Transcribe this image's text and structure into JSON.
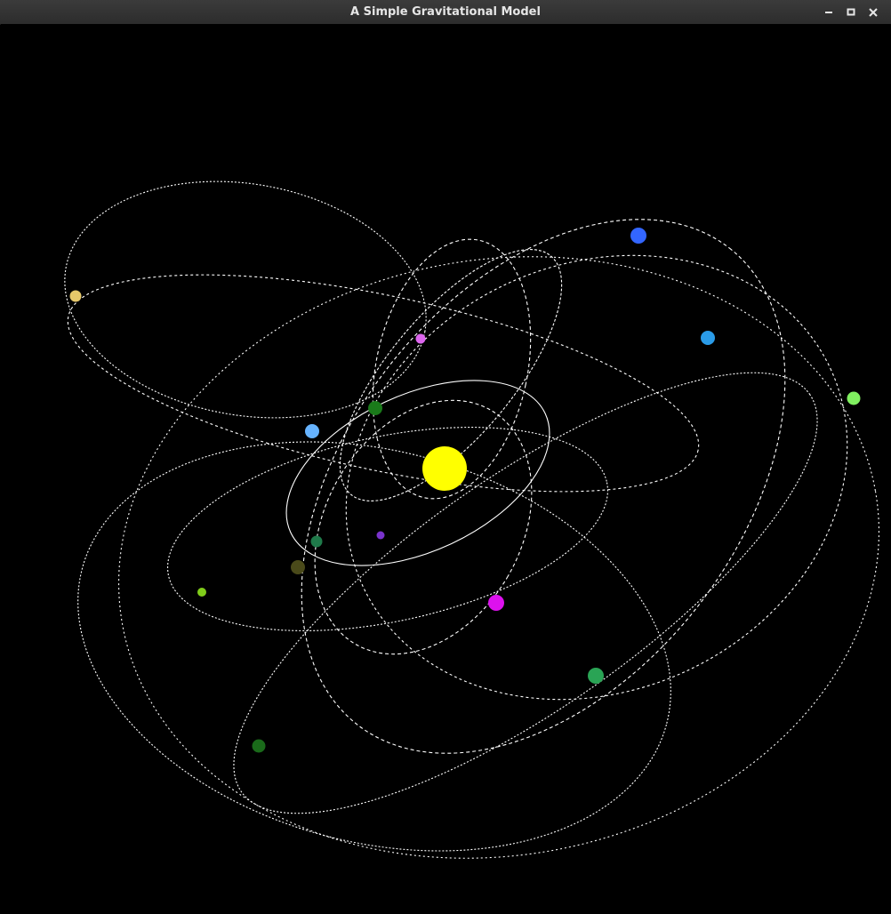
{
  "window": {
    "title": "A Simple Gravitational Model",
    "buttons": [
      {
        "name": "minimize-button",
        "icon": "minimize-icon"
      },
      {
        "name": "maximize-button",
        "icon": "maximize-icon"
      },
      {
        "name": "close-button",
        "icon": "close-icon"
      }
    ]
  },
  "simulation": {
    "background": "#000000",
    "orbit_color": "#ffffff",
    "sun": {
      "color": "#ffff00"
    },
    "bodies": [
      {
        "color": "#3366ff"
      },
      {
        "color": "#2a9be8"
      },
      {
        "color": "#80f060"
      },
      {
        "color": "#e6c86a"
      },
      {
        "color": "#dd66ee"
      },
      {
        "color": "#1a7a1a"
      },
      {
        "color": "#66b3ff"
      },
      {
        "color": "#7a33cc"
      },
      {
        "color": "#1f7a4a"
      },
      {
        "color": "#4a4a1a"
      },
      {
        "color": "#80cc1a"
      },
      {
        "color": "#dd11ee"
      },
      {
        "color": "#2aa455"
      },
      {
        "color": "#1a6a1a"
      }
    ]
  }
}
